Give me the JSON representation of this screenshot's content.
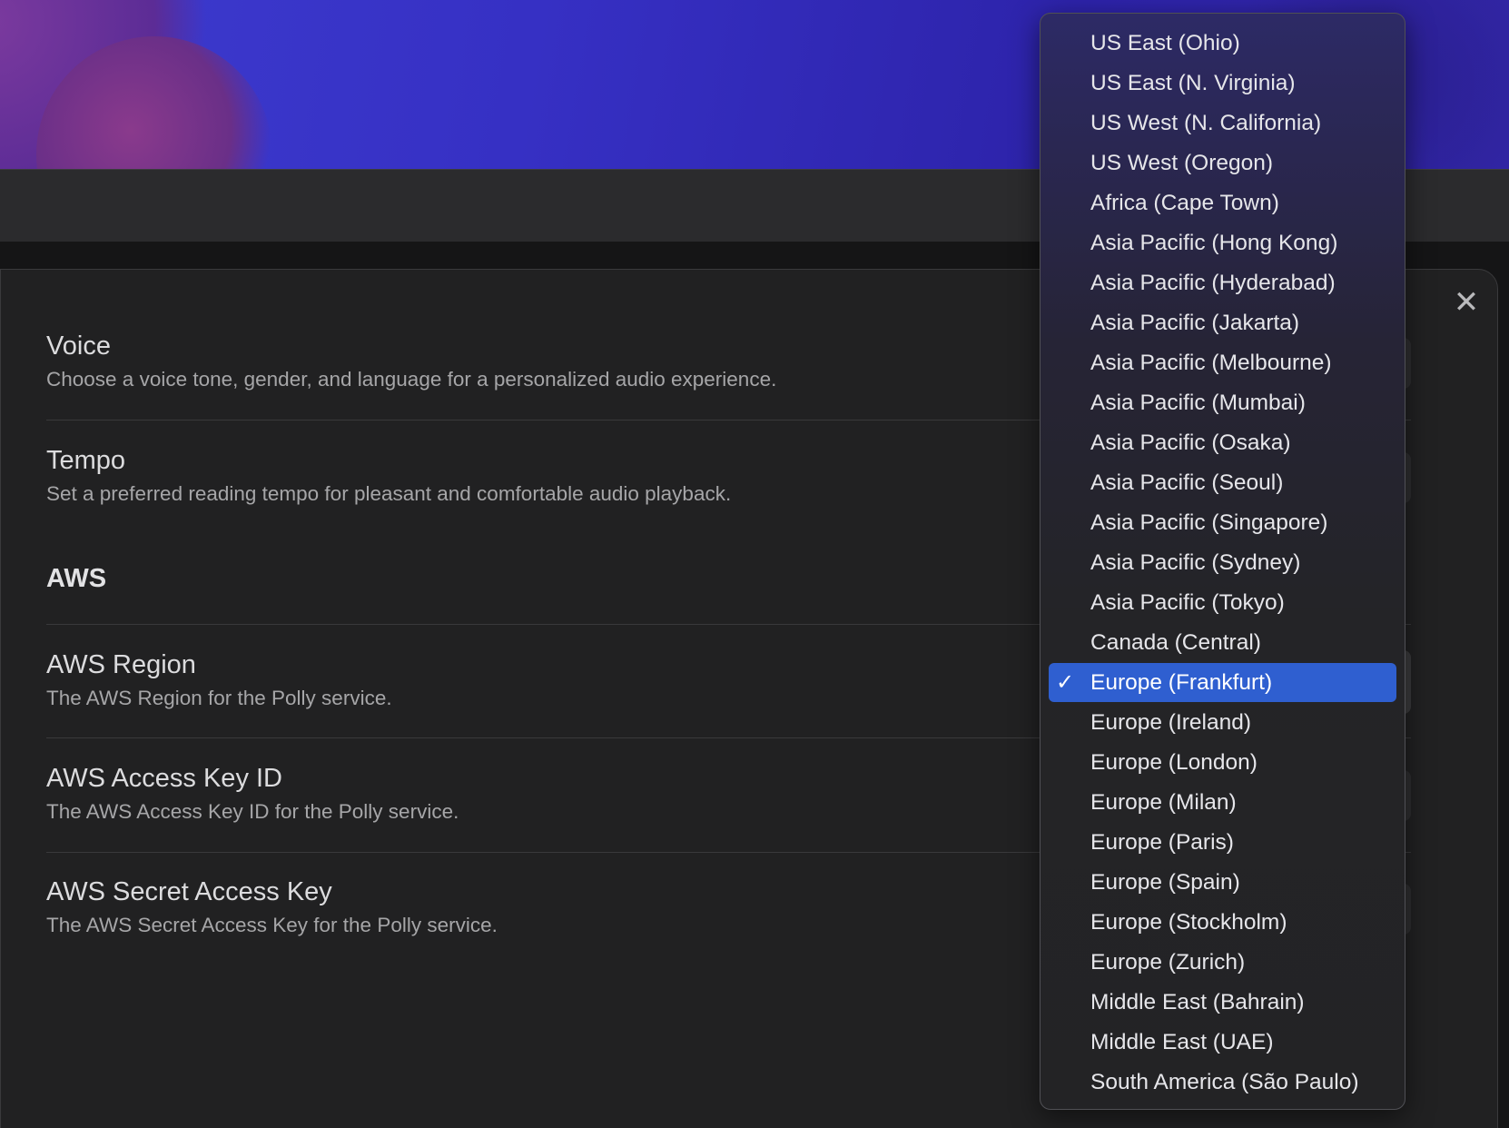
{
  "modal": {
    "close_glyph": "✕",
    "settings": [
      {
        "name": "Voice",
        "description": "Choose a voice tone, gender, and language for a personalized audio experience."
      },
      {
        "name": "Tempo",
        "description": "Set a preferred reading tempo for pleasant and comfortable audio playback."
      }
    ],
    "section_heading": "AWS",
    "aws_settings": [
      {
        "name": "AWS Region",
        "description": "The AWS Region for the Polly service."
      },
      {
        "name": "AWS Access Key ID",
        "description": "The AWS Access Key ID for the Polly service."
      },
      {
        "name": "AWS Secret Access Key",
        "description": "The AWS Secret Access Key for the Polly service."
      }
    ]
  },
  "region_menu": {
    "selected_index": 16,
    "checkmark": "✓",
    "options": [
      "US East (Ohio)",
      "US East (N. Virginia)",
      "US West (N. California)",
      "US West (Oregon)",
      "Africa (Cape Town)",
      "Asia Pacific (Hong Kong)",
      "Asia Pacific (Hyderabad)",
      "Asia Pacific (Jakarta)",
      "Asia Pacific (Melbourne)",
      "Asia Pacific (Mumbai)",
      "Asia Pacific (Osaka)",
      "Asia Pacific (Seoul)",
      "Asia Pacific (Singapore)",
      "Asia Pacific (Sydney)",
      "Asia Pacific (Tokyo)",
      "Canada (Central)",
      "Europe (Frankfurt)",
      "Europe (Ireland)",
      "Europe (London)",
      "Europe (Milan)",
      "Europe (Paris)",
      "Europe (Spain)",
      "Europe (Stockholm)",
      "Europe (Zurich)",
      "Middle East (Bahrain)",
      "Middle East (UAE)",
      "South America (São Paulo)"
    ]
  },
  "colors": {
    "selected_highlight": "#2f5fd0",
    "modal_background": "#212122",
    "wallpaper_blue": "#3630c4"
  }
}
